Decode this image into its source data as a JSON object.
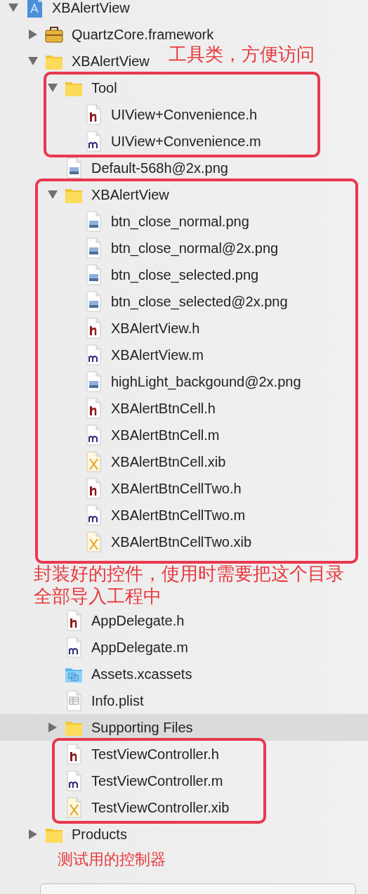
{
  "tree": [
    {
      "name": "XBAlertView",
      "kind": "project",
      "expanded": true,
      "selected": false,
      "children": [
        {
          "name": "QuartzCore.framework",
          "kind": "framework",
          "expanded": false,
          "selected": false
        },
        {
          "name": "XBAlertView",
          "kind": "folder",
          "expanded": true,
          "selected": false,
          "children": [
            {
              "name": "Tool",
              "kind": "folder",
              "expanded": true,
              "selected": false,
              "children": [
                {
                  "name": "UIView+Convenience.h",
                  "kind": "h",
                  "selected": false
                },
                {
                  "name": "UIView+Convenience.m",
                  "kind": "m",
                  "selected": false
                }
              ]
            },
            {
              "name": "Default-568h@2x.png",
              "kind": "png",
              "selected": false
            },
            {
              "name": "XBAlertView",
              "kind": "folder",
              "expanded": true,
              "selected": false,
              "children": [
                {
                  "name": "btn_close_normal.png",
                  "kind": "png",
                  "selected": false
                },
                {
                  "name": "btn_close_normal@2x.png",
                  "kind": "png",
                  "selected": false
                },
                {
                  "name": "btn_close_selected.png",
                  "kind": "png",
                  "selected": false
                },
                {
                  "name": "btn_close_selected@2x.png",
                  "kind": "png",
                  "selected": false
                },
                {
                  "name": "XBAlertView.h",
                  "kind": "h",
                  "selected": false
                },
                {
                  "name": "XBAlertView.m",
                  "kind": "m",
                  "selected": false
                },
                {
                  "name": "highLight_backgound@2x.png",
                  "kind": "png",
                  "selected": false
                },
                {
                  "name": "XBAlertBtnCell.h",
                  "kind": "h",
                  "selected": false
                },
                {
                  "name": "XBAlertBtnCell.m",
                  "kind": "m",
                  "selected": false
                },
                {
                  "name": "XBAlertBtnCell.xib",
                  "kind": "xib",
                  "selected": false
                },
                {
                  "name": "XBAlertBtnCellTwo.h",
                  "kind": "h",
                  "selected": false
                },
                {
                  "name": "XBAlertBtnCellTwo.m",
                  "kind": "m",
                  "selected": false
                },
                {
                  "name": "XBAlertBtnCellTwo.xib",
                  "kind": "xib",
                  "selected": false
                }
              ]
            },
            {
              "name": "AppDelegate.h",
              "kind": "h",
              "selected": false
            },
            {
              "name": "AppDelegate.m",
              "kind": "m",
              "selected": false
            },
            {
              "name": "Assets.xcassets",
              "kind": "xcassets",
              "selected": false
            },
            {
              "name": "Info.plist",
              "kind": "plist",
              "selected": false
            },
            {
              "name": "Supporting Files",
              "kind": "folder",
              "expanded": false,
              "selected": true
            },
            {
              "name": "TestViewController.h",
              "kind": "h",
              "selected": false
            },
            {
              "name": "TestViewController.m",
              "kind": "m",
              "selected": false
            },
            {
              "name": "TestViewController.xib",
              "kind": "xib",
              "selected": false
            }
          ]
        },
        {
          "name": "Products",
          "kind": "folder",
          "expanded": false,
          "selected": false
        }
      ]
    }
  ],
  "annotations": [
    {
      "text": "工具类，方便访问"
    },
    {
      "text": "封装好的控件，使用时需要把这个目录全部导入工程中"
    },
    {
      "text": "测试用的控制器"
    }
  ]
}
